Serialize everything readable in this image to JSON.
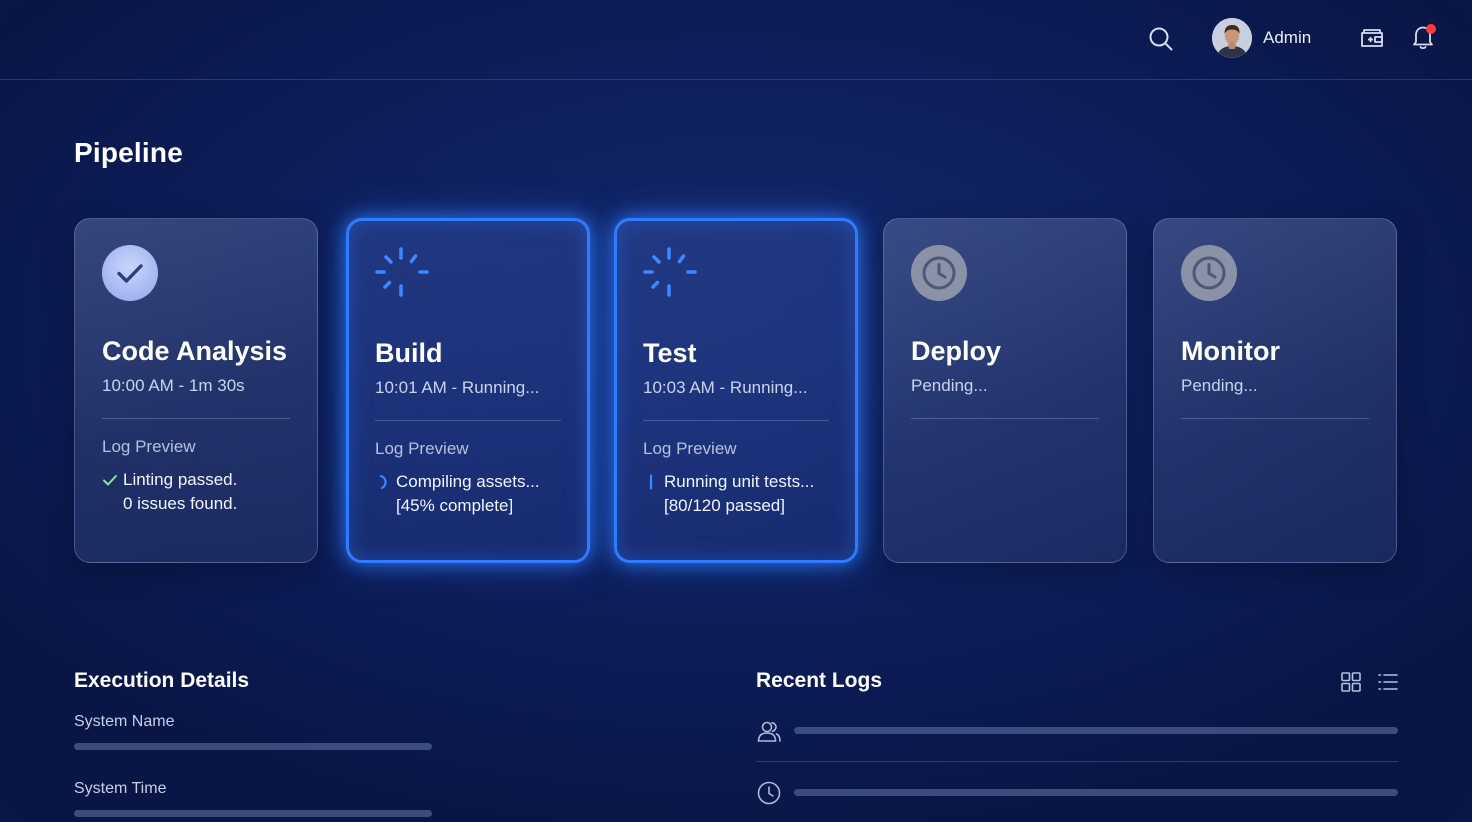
{
  "header": {
    "user_name": "Admin",
    "icons": [
      "search-icon",
      "wallet-icon",
      "bell-icon"
    ],
    "notification_dot": true
  },
  "page": {
    "title": "Pipeline"
  },
  "pipeline": {
    "stages": [
      {
        "title": "Code Analysis",
        "subtitle": "10:00 AM - 1m 30s",
        "status": "success",
        "log_label": "Log Preview",
        "log_line1": "Linting passed.",
        "log_line2": "0 issues found."
      },
      {
        "title": "Build",
        "subtitle": "10:01 AM - Running...",
        "status": "running",
        "log_label": "Log Preview",
        "log_line1": "Compiling assets...",
        "log_line2": "[45% complete]"
      },
      {
        "title": "Test",
        "subtitle": "10:03 AM - Running...",
        "status": "running",
        "log_label": "Log Preview",
        "log_line1": "Running unit tests...",
        "log_line2": "[80/120 passed]"
      },
      {
        "title": "Deploy",
        "subtitle": "Pending...",
        "status": "pending"
      },
      {
        "title": "Monitor",
        "subtitle": "Pending...",
        "status": "pending"
      }
    ]
  },
  "execution": {
    "title": "Execution Details",
    "fields": [
      {
        "label": "System Name"
      },
      {
        "label": "System Time"
      }
    ]
  },
  "logs": {
    "title": "Recent Logs",
    "rows": [
      {
        "icon": "users-icon"
      },
      {
        "icon": "clock-icon"
      }
    ]
  },
  "colors": {
    "background": "#0b1a52",
    "accent": "#2f7cff",
    "success_icon_bg": "#b3c3f5",
    "notification": "#ff3b3b"
  }
}
